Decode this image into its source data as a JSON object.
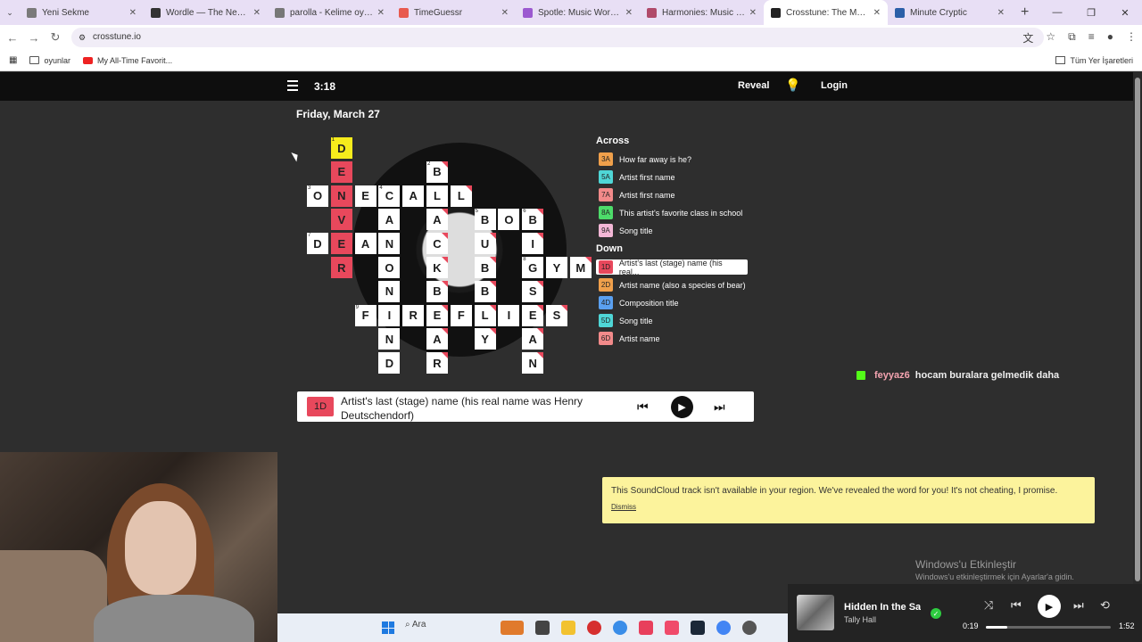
{
  "browser": {
    "tabs": [
      {
        "title": "Yeni Sekme",
        "color": "#7a7a7a"
      },
      {
        "title": "Wordle — The New York Times",
        "color": "#333333"
      },
      {
        "title": "parolla - Kelime oyunu. Günlük",
        "color": "#777777"
      },
      {
        "title": "TimeGuessr",
        "color": "#e85a4f"
      },
      {
        "title": "Spotle: Music Wordle Game",
        "color": "#9b59d0"
      },
      {
        "title": "Harmonies: Music Connections",
        "color": "#b04a6a"
      },
      {
        "title": "Crosstune: The Music Crossword",
        "color": "#222222"
      },
      {
        "title": "Minute Cryptic",
        "color": "#2b5fa8"
      }
    ],
    "active_tab": 6,
    "new_tab": "+",
    "url": "crosstune.io",
    "bookmarks": [
      {
        "label": "oyunlar",
        "icon": "folder-icon"
      },
      {
        "label": "My All-Time Favorit...",
        "icon": "youtube-icon"
      }
    ],
    "bookmarks_right": "Tüm Yer İşaretleri"
  },
  "app": {
    "timer": "3:18",
    "reveal_label": "Reveal",
    "login_label": "Login",
    "date": "Friday, March 27"
  },
  "grid": {
    "cells": [
      {
        "r": 0,
        "c": 1,
        "l": "D",
        "n": "1",
        "s": "yl"
      },
      {
        "r": 1,
        "c": 1,
        "l": "E",
        "s": "rd"
      },
      {
        "r": 1,
        "c": 5,
        "l": "B",
        "n": "2",
        "k": 1
      },
      {
        "r": 2,
        "c": 0,
        "l": "O",
        "n": "3"
      },
      {
        "r": 2,
        "c": 1,
        "l": "N",
        "s": "rd"
      },
      {
        "r": 2,
        "c": 2,
        "l": "E"
      },
      {
        "r": 2,
        "c": 3,
        "l": "C",
        "n": "4"
      },
      {
        "r": 2,
        "c": 4,
        "l": "A"
      },
      {
        "r": 2,
        "c": 5,
        "l": "L"
      },
      {
        "r": 2,
        "c": 6,
        "l": "L",
        "k": 1
      },
      {
        "r": 3,
        "c": 1,
        "l": "V",
        "s": "rd"
      },
      {
        "r": 3,
        "c": 3,
        "l": "A"
      },
      {
        "r": 3,
        "c": 5,
        "l": "A",
        "k": 1
      },
      {
        "r": 3,
        "c": 7,
        "l": "B",
        "n": "5"
      },
      {
        "r": 3,
        "c": 8,
        "l": "O"
      },
      {
        "r": 3,
        "c": 9,
        "l": "B",
        "n": "6",
        "k": 1
      },
      {
        "r": 4,
        "c": 0,
        "l": "D",
        "n": "7"
      },
      {
        "r": 4,
        "c": 1,
        "l": "E",
        "s": "rd"
      },
      {
        "r": 4,
        "c": 2,
        "l": "A"
      },
      {
        "r": 4,
        "c": 3,
        "l": "N"
      },
      {
        "r": 4,
        "c": 5,
        "l": "C",
        "k": 1
      },
      {
        "r": 4,
        "c": 7,
        "l": "U",
        "k": 1
      },
      {
        "r": 4,
        "c": 9,
        "l": "I",
        "k": 1
      },
      {
        "r": 5,
        "c": 1,
        "l": "R",
        "s": "rd"
      },
      {
        "r": 5,
        "c": 3,
        "l": "O"
      },
      {
        "r": 5,
        "c": 5,
        "l": "K",
        "k": 1
      },
      {
        "r": 5,
        "c": 7,
        "l": "B",
        "k": 1
      },
      {
        "r": 5,
        "c": 9,
        "l": "G",
        "n": "8"
      },
      {
        "r": 5,
        "c": 10,
        "l": "Y"
      },
      {
        "r": 5,
        "c": 11,
        "l": "M",
        "k": 1
      },
      {
        "r": 6,
        "c": 3,
        "l": "N"
      },
      {
        "r": 6,
        "c": 5,
        "l": "B",
        "k": 1
      },
      {
        "r": 6,
        "c": 7,
        "l": "B",
        "k": 1
      },
      {
        "r": 6,
        "c": 9,
        "l": "S",
        "k": 1
      },
      {
        "r": 7,
        "c": 2,
        "l": "F",
        "n": "9"
      },
      {
        "r": 7,
        "c": 3,
        "l": "I"
      },
      {
        "r": 7,
        "c": 4,
        "l": "R"
      },
      {
        "r": 7,
        "c": 5,
        "l": "E",
        "k": 1
      },
      {
        "r": 7,
        "c": 6,
        "l": "F"
      },
      {
        "r": 7,
        "c": 7,
        "l": "L",
        "k": 1
      },
      {
        "r": 7,
        "c": 8,
        "l": "I"
      },
      {
        "r": 7,
        "c": 9,
        "l": "E",
        "k": 1
      },
      {
        "r": 7,
        "c": 10,
        "l": "S",
        "k": 1
      },
      {
        "r": 8,
        "c": 3,
        "l": "N"
      },
      {
        "r": 8,
        "c": 5,
        "l": "A",
        "k": 1
      },
      {
        "r": 8,
        "c": 7,
        "l": "Y",
        "k": 1
      },
      {
        "r": 8,
        "c": 9,
        "l": "A",
        "k": 1
      },
      {
        "r": 9,
        "c": 3,
        "l": "D"
      },
      {
        "r": 9,
        "c": 5,
        "l": "R",
        "k": 1
      },
      {
        "r": 9,
        "c": 9,
        "l": "N",
        "k": 1
      }
    ]
  },
  "clues": {
    "across_title": "Across",
    "down_title": "Down",
    "across": [
      {
        "tag": "3A",
        "text": "How far away is he?",
        "color": "#f0a04b"
      },
      {
        "tag": "5A",
        "text": "Artist first name",
        "color": "#4fd6d6"
      },
      {
        "tag": "7A",
        "text": "Artist first name",
        "color": "#f28a8a"
      },
      {
        "tag": "8A",
        "text": "This artist's favorite class in school",
        "color": "#4ddc6a"
      },
      {
        "tag": "9A",
        "text": "Song title",
        "color": "#f3b7d6"
      }
    ],
    "down": [
      {
        "tag": "1D",
        "text": "Artist's last (stage) name (his real...",
        "color": "#e8485c",
        "selected": true
      },
      {
        "tag": "2D",
        "text": "Artist name (also a species of bear)",
        "color": "#f0a04b"
      },
      {
        "tag": "4D",
        "text": "Composition title",
        "color": "#5aa0f0"
      },
      {
        "tag": "5D",
        "text": "Song title",
        "color": "#4fd6d6"
      },
      {
        "tag": "6D",
        "text": "Artist name",
        "color": "#f28a8a"
      }
    ]
  },
  "current_clue": {
    "tag": "1D",
    "text": "Artist's last (stage) name (his real name was Henry Deutschendorf)"
  },
  "chat": {
    "user": "feyyaz6",
    "message": "hocam buralara gelmedik daha"
  },
  "notice": {
    "message": "This SoundCloud track isn't available in your region. We've revealed the word for you! It's not cheating, I promise.",
    "dismiss": "Dismiss"
  },
  "watermark": {
    "line1": "Windows'u Etkinleştir",
    "line2": "Windows'u etkinleştirmek için Ayarlar'a gidin."
  },
  "taskbar": {
    "search": "Ara"
  },
  "media": {
    "title": "Hidden In the Sand",
    "artist": "Tally Hall",
    "elapsed": "0:19",
    "total": "1:52",
    "progress": 0.17
  }
}
